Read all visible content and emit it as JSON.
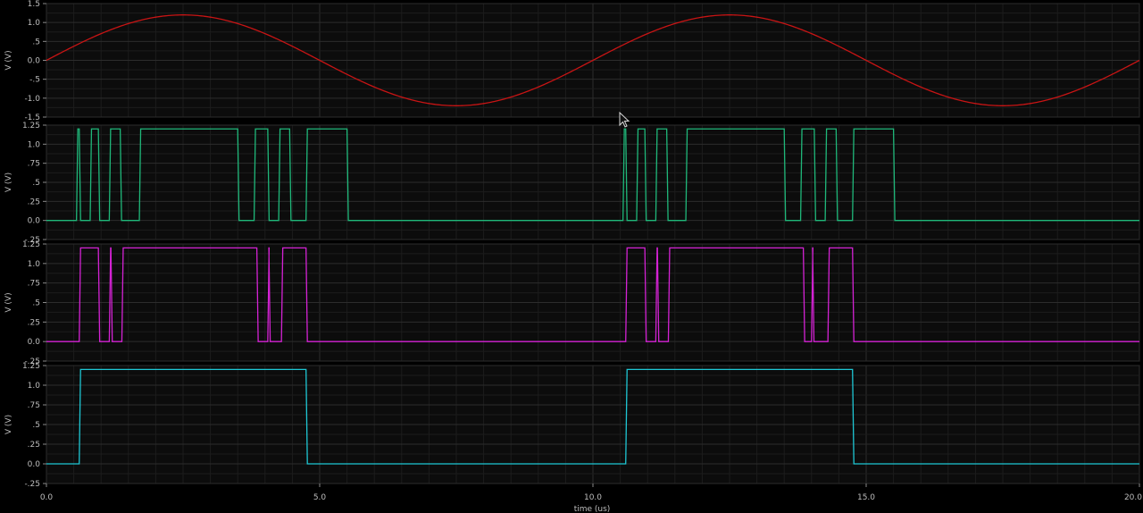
{
  "chart_data": {
    "type": "line",
    "xlabel": "time (us)",
    "x_ticks": [
      "0.0",
      "5.0",
      "10.0",
      "15.0",
      "20.0"
    ],
    "xlim": [
      0,
      20
    ],
    "grid": true,
    "panels": [
      {
        "name": "sine",
        "ylabel": "V (V)",
        "ylim": [
          -1.5,
          1.5
        ],
        "y_ticks": [
          "1.5",
          "1.0",
          ".5",
          "0.0",
          "-.5",
          "-1.0",
          "-1.5"
        ],
        "color": "#c81414",
        "series": [
          {
            "kind": "sine",
            "amplitude": 1.2,
            "period_us": 10.0,
            "values_note": "",
            "x": [
              0,
              2.5,
              5,
              7.5,
              10,
              12.5,
              15,
              17.5,
              20
            ],
            "y": [
              0,
              1.2,
              0,
              -1.2,
              0,
              1.2,
              0,
              -1.2,
              0
            ]
          }
        ]
      },
      {
        "name": "digital1",
        "ylabel": "V (V)",
        "ylim": [
          -0.25,
          1.2
        ],
        "y_ticks": [
          "1.25",
          "1.0",
          ".75",
          ".5",
          ".25",
          "0.0",
          "-.25"
        ],
        "color": "#1fb87a",
        "high": 1.2,
        "pulses": [
          [
            0.55,
            0.6
          ],
          [
            0.8,
            0.95
          ],
          [
            1.15,
            1.35
          ],
          [
            1.7,
            3.5
          ],
          [
            3.8,
            4.05
          ],
          [
            4.25,
            4.45
          ],
          [
            4.75,
            5.5
          ],
          [
            10.55,
            10.6
          ],
          [
            10.8,
            10.95
          ],
          [
            11.15,
            11.35
          ],
          [
            11.7,
            13.5
          ],
          [
            13.8,
            14.05
          ],
          [
            14.25,
            14.45
          ],
          [
            14.75,
            15.5
          ]
        ]
      },
      {
        "name": "digital2",
        "ylabel": "V (V)",
        "ylim": [
          -0.25,
          1.25
        ],
        "y_ticks": [
          "1.25",
          "1.0",
          ".75",
          ".5",
          ".25",
          "0.0",
          "-.25"
        ],
        "color": "#d422d4",
        "high": 1.2,
        "pulses": [
          [
            0.6,
            0.95
          ],
          [
            1.15,
            1.18
          ],
          [
            1.38,
            3.85
          ],
          [
            4.05,
            4.07
          ],
          [
            4.3,
            4.75
          ],
          [
            10.6,
            10.95
          ],
          [
            11.15,
            11.18
          ],
          [
            11.38,
            13.85
          ],
          [
            14.0,
            14.02
          ],
          [
            14.3,
            14.75
          ]
        ]
      },
      {
        "name": "digital3",
        "ylabel": "V (V)",
        "ylim": [
          -0.25,
          1.25
        ],
        "y_ticks": [
          "1.25",
          "1.0",
          ".75",
          ".5",
          ".25",
          "0.0",
          "-.25"
        ],
        "color": "#1ec7d4",
        "high": 1.2,
        "pulses": [
          [
            0.6,
            4.75
          ],
          [
            10.6,
            14.75
          ]
        ]
      }
    ]
  }
}
